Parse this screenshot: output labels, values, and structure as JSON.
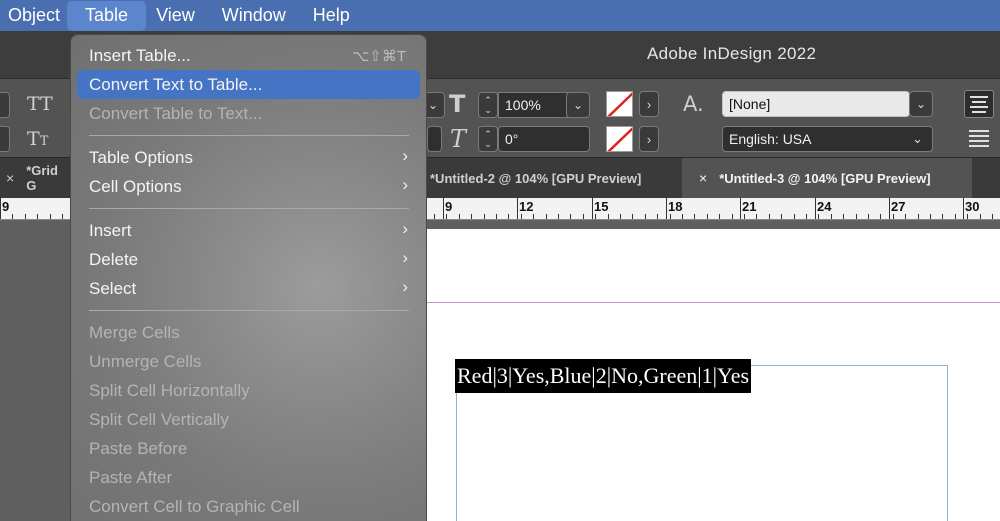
{
  "menubar": {
    "items": [
      "Object",
      "Table",
      "View",
      "Window",
      "Help"
    ]
  },
  "app": {
    "title": "Adobe InDesign 2022"
  },
  "control": {
    "scale": "100%",
    "angle": "0°",
    "char_style": "[None]",
    "language": "English: USA"
  },
  "tabs": [
    "*Grid G",
    "*Untitled-2 @ 104% [GPU Preview]",
    "*Untitled-3 @ 104% [GPU Preview]"
  ],
  "tab_close": "×",
  "ruler": {
    "labels": [
      "9",
      "9",
      "12",
      "15",
      "18",
      "21",
      "24",
      "27",
      "30"
    ]
  },
  "document": {
    "selected_text": "Red|3|Yes,Blue|2|No,Green|1|Yes"
  },
  "table_menu": {
    "insert_table": "Insert Table...",
    "insert_table_shortcut": "⌥⇧⌘T",
    "convert_text_to_table": "Convert Text to Table...",
    "convert_table_to_text": "Convert Table to Text...",
    "table_options": "Table Options",
    "cell_options": "Cell Options",
    "insert": "Insert",
    "delete": "Delete",
    "select": "Select",
    "merge_cells": "Merge Cells",
    "unmerge_cells": "Unmerge Cells",
    "split_horizontally": "Split Cell Horizontally",
    "split_vertically": "Split Cell Vertically",
    "paste_before": "Paste Before",
    "paste_after": "Paste After",
    "convert_cell_to_graphic": "Convert Cell to Graphic Cell"
  },
  "icons": {
    "submenu": "chevron-right-icon",
    "dropdown": "chevron-down-icon",
    "stepper": "stepper-icon"
  },
  "colors": {
    "menubar": "#4a6fb0",
    "highlight": "#4674c4",
    "guide": "#d38ad8",
    "frame": "#8fb0e2"
  }
}
